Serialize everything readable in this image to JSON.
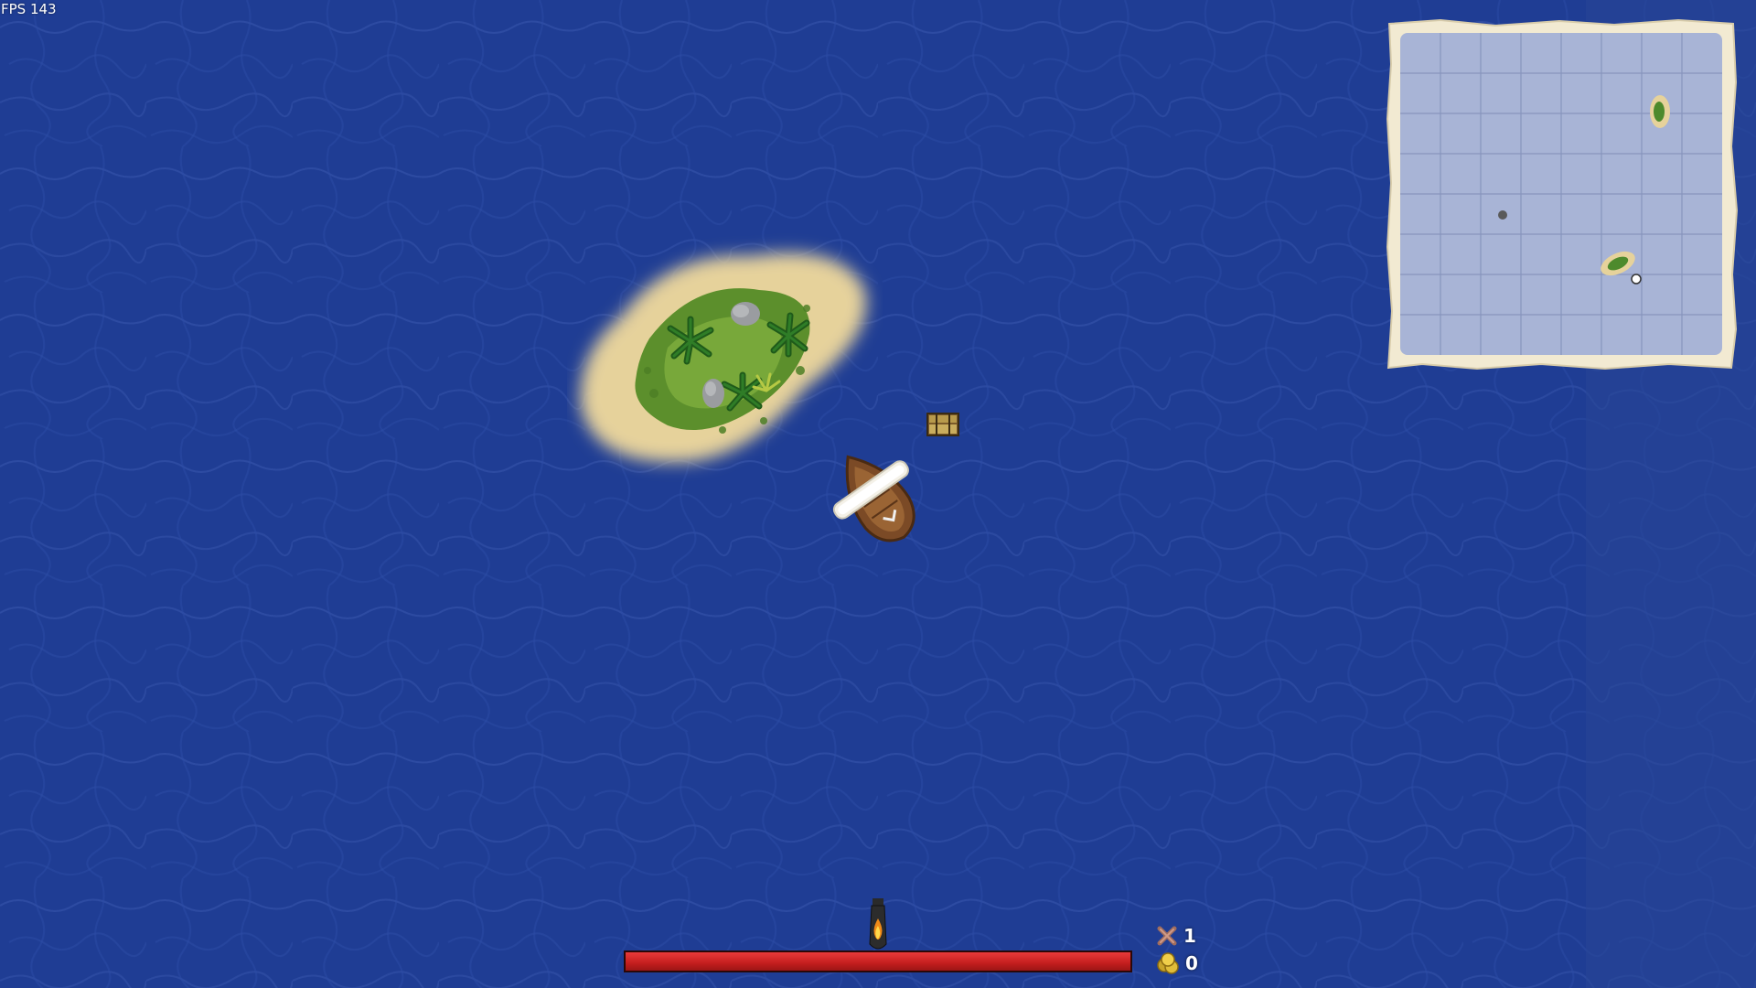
{
  "hud": {
    "fps_text": "FPS 143",
    "kills_value": "1",
    "gold_value": "0",
    "health_fraction": 1.0
  },
  "icons": {
    "kills": "crossed-bones-icon",
    "gold": "coin-stack-icon",
    "cannon": "cannon-fire-icon"
  },
  "colors": {
    "ocean": "#1f3d94",
    "sand": "#e6d29b",
    "health": "#c41e1e",
    "minimap_paper": "#f2ead2",
    "minimap_water": "#a8b4d6"
  }
}
